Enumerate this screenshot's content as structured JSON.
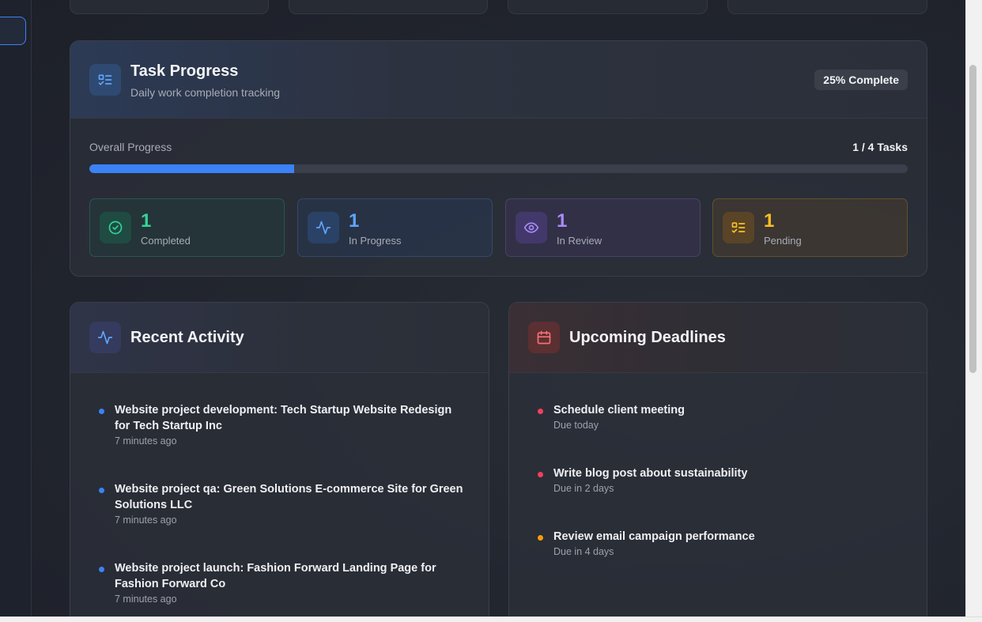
{
  "task_progress": {
    "title": "Task Progress",
    "subtitle": "Daily work completion tracking",
    "badge": "25% Complete",
    "progress_label": "Overall Progress",
    "progress_count": "1 / 4 Tasks",
    "progress_fraction": 0.25,
    "stats": [
      {
        "value": "1",
        "label": "Completed",
        "color": "#34d399",
        "icon": "check-circle-icon"
      },
      {
        "value": "1",
        "label": "In Progress",
        "color": "#60a5fa",
        "icon": "activity-icon"
      },
      {
        "value": "1",
        "label": "In Review",
        "color": "#a78bfa",
        "icon": "eye-icon"
      },
      {
        "value": "1",
        "label": "Pending",
        "color": "#fbbf24",
        "icon": "list-check-icon"
      }
    ]
  },
  "recent_activity": {
    "title": "Recent Activity",
    "items": [
      {
        "text": "Website project development: Tech Startup Website Redesign for Tech Startup Inc",
        "time": "7 minutes ago"
      },
      {
        "text": "Website project qa: Green Solutions E-commerce Site for Green Solutions LLC",
        "time": "7 minutes ago"
      },
      {
        "text": "Website project launch: Fashion Forward Landing Page for Fashion Forward Co",
        "time": "7 minutes ago"
      }
    ]
  },
  "upcoming_deadlines": {
    "title": "Upcoming Deadlines",
    "items": [
      {
        "text": "Schedule client meeting",
        "due": "Due today",
        "color": "#f43f5e"
      },
      {
        "text": "Write blog post about sustainability",
        "due": "Due in 2 days",
        "color": "#f43f5e"
      },
      {
        "text": "Review email campaign performance",
        "due": "Due in 4 days",
        "color": "#f59e0b"
      }
    ]
  },
  "colors": {
    "accent": "#3b82f6",
    "completed": "#34d399",
    "in_progress": "#60a5fa",
    "in_review": "#a78bfa",
    "pending": "#fbbf24",
    "deadline_urgent": "#f43f5e",
    "deadline_soon": "#f59e0b"
  }
}
